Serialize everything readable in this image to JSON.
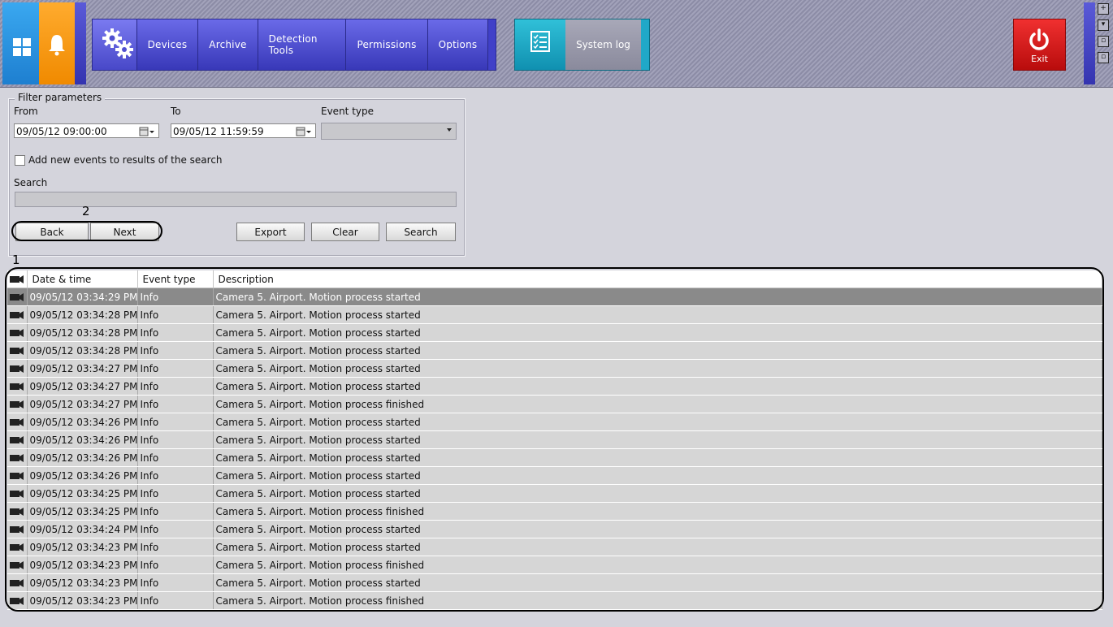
{
  "topbar": {
    "menu": [
      "Devices",
      "Archive",
      "Detection Tools",
      "Permissions",
      "Options"
    ],
    "system_log_label": "System log",
    "exit_label": "Exit",
    "icons": {
      "windows": "windows-icon",
      "alerts": "bell-icon",
      "settings": "gears-icon",
      "system_log": "checklist-icon",
      "exit": "power-icon"
    },
    "colors": {
      "windows_tile": "#2a90e0",
      "bell_tile": "#f89a10",
      "menu": "#4a4ad0",
      "system_log": "#18a0c0",
      "exit": "#d81a1a"
    }
  },
  "filter": {
    "legend": "Filter parameters",
    "from_label": "From",
    "from_value": "09/05/12 09:00:00",
    "to_label": "To",
    "to_value": "09/05/12 11:59:59",
    "event_type_label": "Event type",
    "event_type_value": "",
    "add_new_label": "Add new events to results of the search",
    "add_new_checked": false,
    "search_label": "Search",
    "search_value": "",
    "back_label": "Back",
    "next_label": "Next",
    "export_label": "Export",
    "clear_label": "Clear",
    "search_button_label": "Search"
  },
  "annotations": {
    "marker_1": "1",
    "marker_2": "2"
  },
  "table": {
    "columns": [
      "",
      "Date & time",
      "Event type",
      "Description"
    ],
    "selected_row": 0,
    "rows": [
      {
        "datetime": "09/05/12 03:34:29 PM",
        "type": "Info",
        "description": "Camera 5. Airport. Motion process started"
      },
      {
        "datetime": "09/05/12 03:34:28 PM",
        "type": "Info",
        "description": "Camera 5. Airport. Motion process started"
      },
      {
        "datetime": "09/05/12 03:34:28 PM",
        "type": "Info",
        "description": "Camera 5. Airport. Motion process started"
      },
      {
        "datetime": "09/05/12 03:34:28 PM",
        "type": "Info",
        "description": "Camera 5. Airport. Motion process started"
      },
      {
        "datetime": "09/05/12 03:34:27 PM",
        "type": "Info",
        "description": "Camera 5. Airport. Motion process started"
      },
      {
        "datetime": "09/05/12 03:34:27 PM",
        "type": "Info",
        "description": "Camera 5. Airport. Motion process started"
      },
      {
        "datetime": "09/05/12 03:34:27 PM",
        "type": "Info",
        "description": "Camera 5. Airport. Motion process finished"
      },
      {
        "datetime": "09/05/12 03:34:26 PM",
        "type": "Info",
        "description": "Camera 5. Airport. Motion process started"
      },
      {
        "datetime": "09/05/12 03:34:26 PM",
        "type": "Info",
        "description": "Camera 5. Airport. Motion process started"
      },
      {
        "datetime": "09/05/12 03:34:26 PM",
        "type": "Info",
        "description": "Camera 5. Airport. Motion process started"
      },
      {
        "datetime": "09/05/12 03:34:26 PM",
        "type": "Info",
        "description": "Camera 5. Airport. Motion process started"
      },
      {
        "datetime": "09/05/12 03:34:25 PM",
        "type": "Info",
        "description": "Camera 5. Airport. Motion process started"
      },
      {
        "datetime": "09/05/12 03:34:25 PM",
        "type": "Info",
        "description": "Camera 5. Airport. Motion process finished"
      },
      {
        "datetime": "09/05/12 03:34:24 PM",
        "type": "Info",
        "description": "Camera 5. Airport. Motion process started"
      },
      {
        "datetime": "09/05/12 03:34:23 PM",
        "type": "Info",
        "description": "Camera 5. Airport. Motion process started"
      },
      {
        "datetime": "09/05/12 03:34:23 PM",
        "type": "Info",
        "description": "Camera 5. Airport. Motion process finished"
      },
      {
        "datetime": "09/05/12 03:34:23 PM",
        "type": "Info",
        "description": "Camera 5. Airport. Motion process started"
      },
      {
        "datetime": "09/05/12 03:34:23 PM",
        "type": "Info",
        "description": "Camera 5. Airport. Motion process finished"
      }
    ]
  }
}
